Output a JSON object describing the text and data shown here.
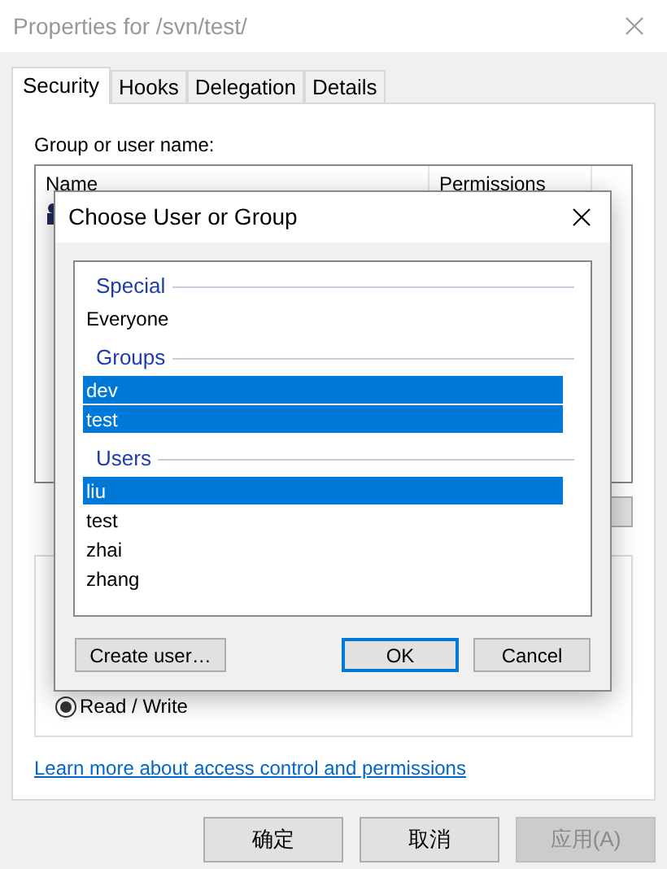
{
  "window": {
    "title": "Properties for /svn/test/"
  },
  "tabs": [
    {
      "label": "Security",
      "selected": true
    },
    {
      "label": "Hooks",
      "selected": false
    },
    {
      "label": "Delegation",
      "selected": false
    },
    {
      "label": "Details",
      "selected": false
    }
  ],
  "security": {
    "list_label": "Group or user name:",
    "columns": [
      "Name",
      "Permissions"
    ],
    "radio": {
      "label": "Read / Write",
      "selected": true
    },
    "link": "Learn more about access control and permissions"
  },
  "dialog": {
    "title": "Choose User or Group",
    "sections": [
      {
        "header": "Special",
        "items": [
          {
            "label": "Everyone",
            "selected": false
          }
        ]
      },
      {
        "header": "Groups",
        "items": [
          {
            "label": "dev",
            "selected": true
          },
          {
            "label": "test",
            "selected": true
          }
        ]
      },
      {
        "header": "Users",
        "items": [
          {
            "label": "liu",
            "selected": true
          },
          {
            "label": "test",
            "selected": false
          },
          {
            "label": "zhai",
            "selected": false
          },
          {
            "label": "zhang",
            "selected": false
          }
        ]
      }
    ],
    "buttons": [
      {
        "label": "Create user…",
        "kind": "left",
        "default": false
      },
      {
        "label": "OK",
        "kind": "right",
        "default": true
      },
      {
        "label": "Cancel",
        "kind": "right",
        "default": false
      }
    ]
  },
  "buttons": [
    {
      "label": "确定",
      "disabled": false
    },
    {
      "label": "取消",
      "disabled": false
    },
    {
      "label": "应用(A)",
      "disabled": true
    }
  ]
}
